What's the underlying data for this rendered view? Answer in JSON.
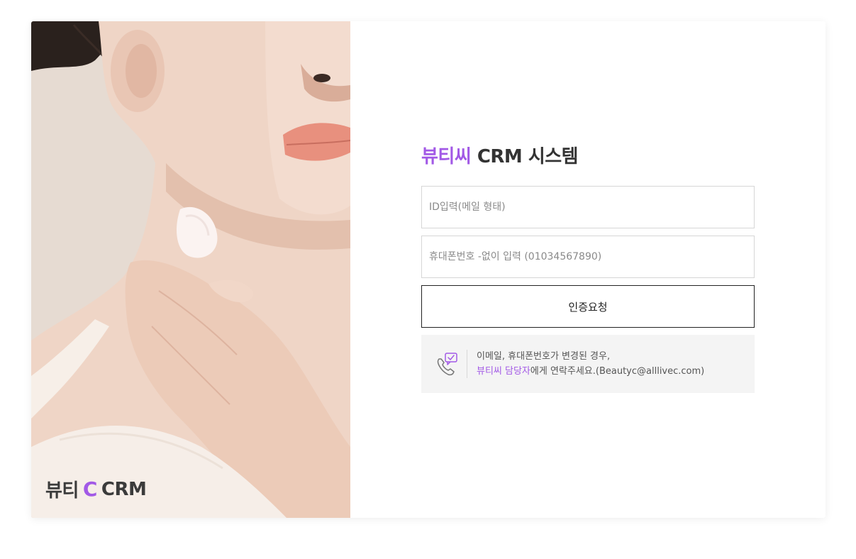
{
  "photo": {
    "logo_text_left": "뷰티",
    "logo_c": "C",
    "logo_text_right": "CRM"
  },
  "login": {
    "title_brand": "뷰티씨",
    "title_rest": " CRM 시스템",
    "id_placeholder": "ID입력(메일 형태)",
    "phone_placeholder": "휴대폰번호 -없이 입력 (01034567890)",
    "submit_label": "인증요청",
    "notice_line1": "이메일, 휴대폰번호가 변경된 경우,",
    "notice_line2_highlight": "뷰티씨 담당자",
    "notice_line2_rest": "에게 연락주세요.(Beautyc@alllivec.com)"
  },
  "colors": {
    "brand": "#a259e6",
    "text_dark": "#333333",
    "notice_bg": "#f4f4f4"
  }
}
